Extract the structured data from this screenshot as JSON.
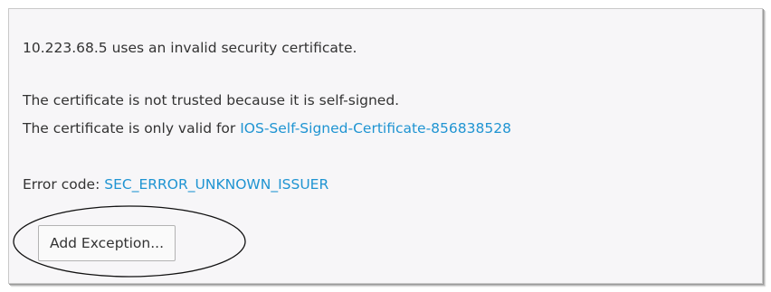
{
  "error_page": {
    "summary": "10.223.68.5 uses an invalid security certificate.",
    "reason": "The certificate is not trusted because it is self-signed.",
    "valid_for_prefix": "The certificate is only valid for ",
    "valid_for_name": "IOS-Self-Signed-Certificate-856838528",
    "error_code_prefix": "Error code: ",
    "error_code": "SEC_ERROR_UNKNOWN_ISSUER",
    "add_exception_label": "Add Exception..."
  },
  "colors": {
    "link": "#1f94d2",
    "text": "#333333",
    "panel_background": "#f7f6f8",
    "annotation": "#111111"
  }
}
